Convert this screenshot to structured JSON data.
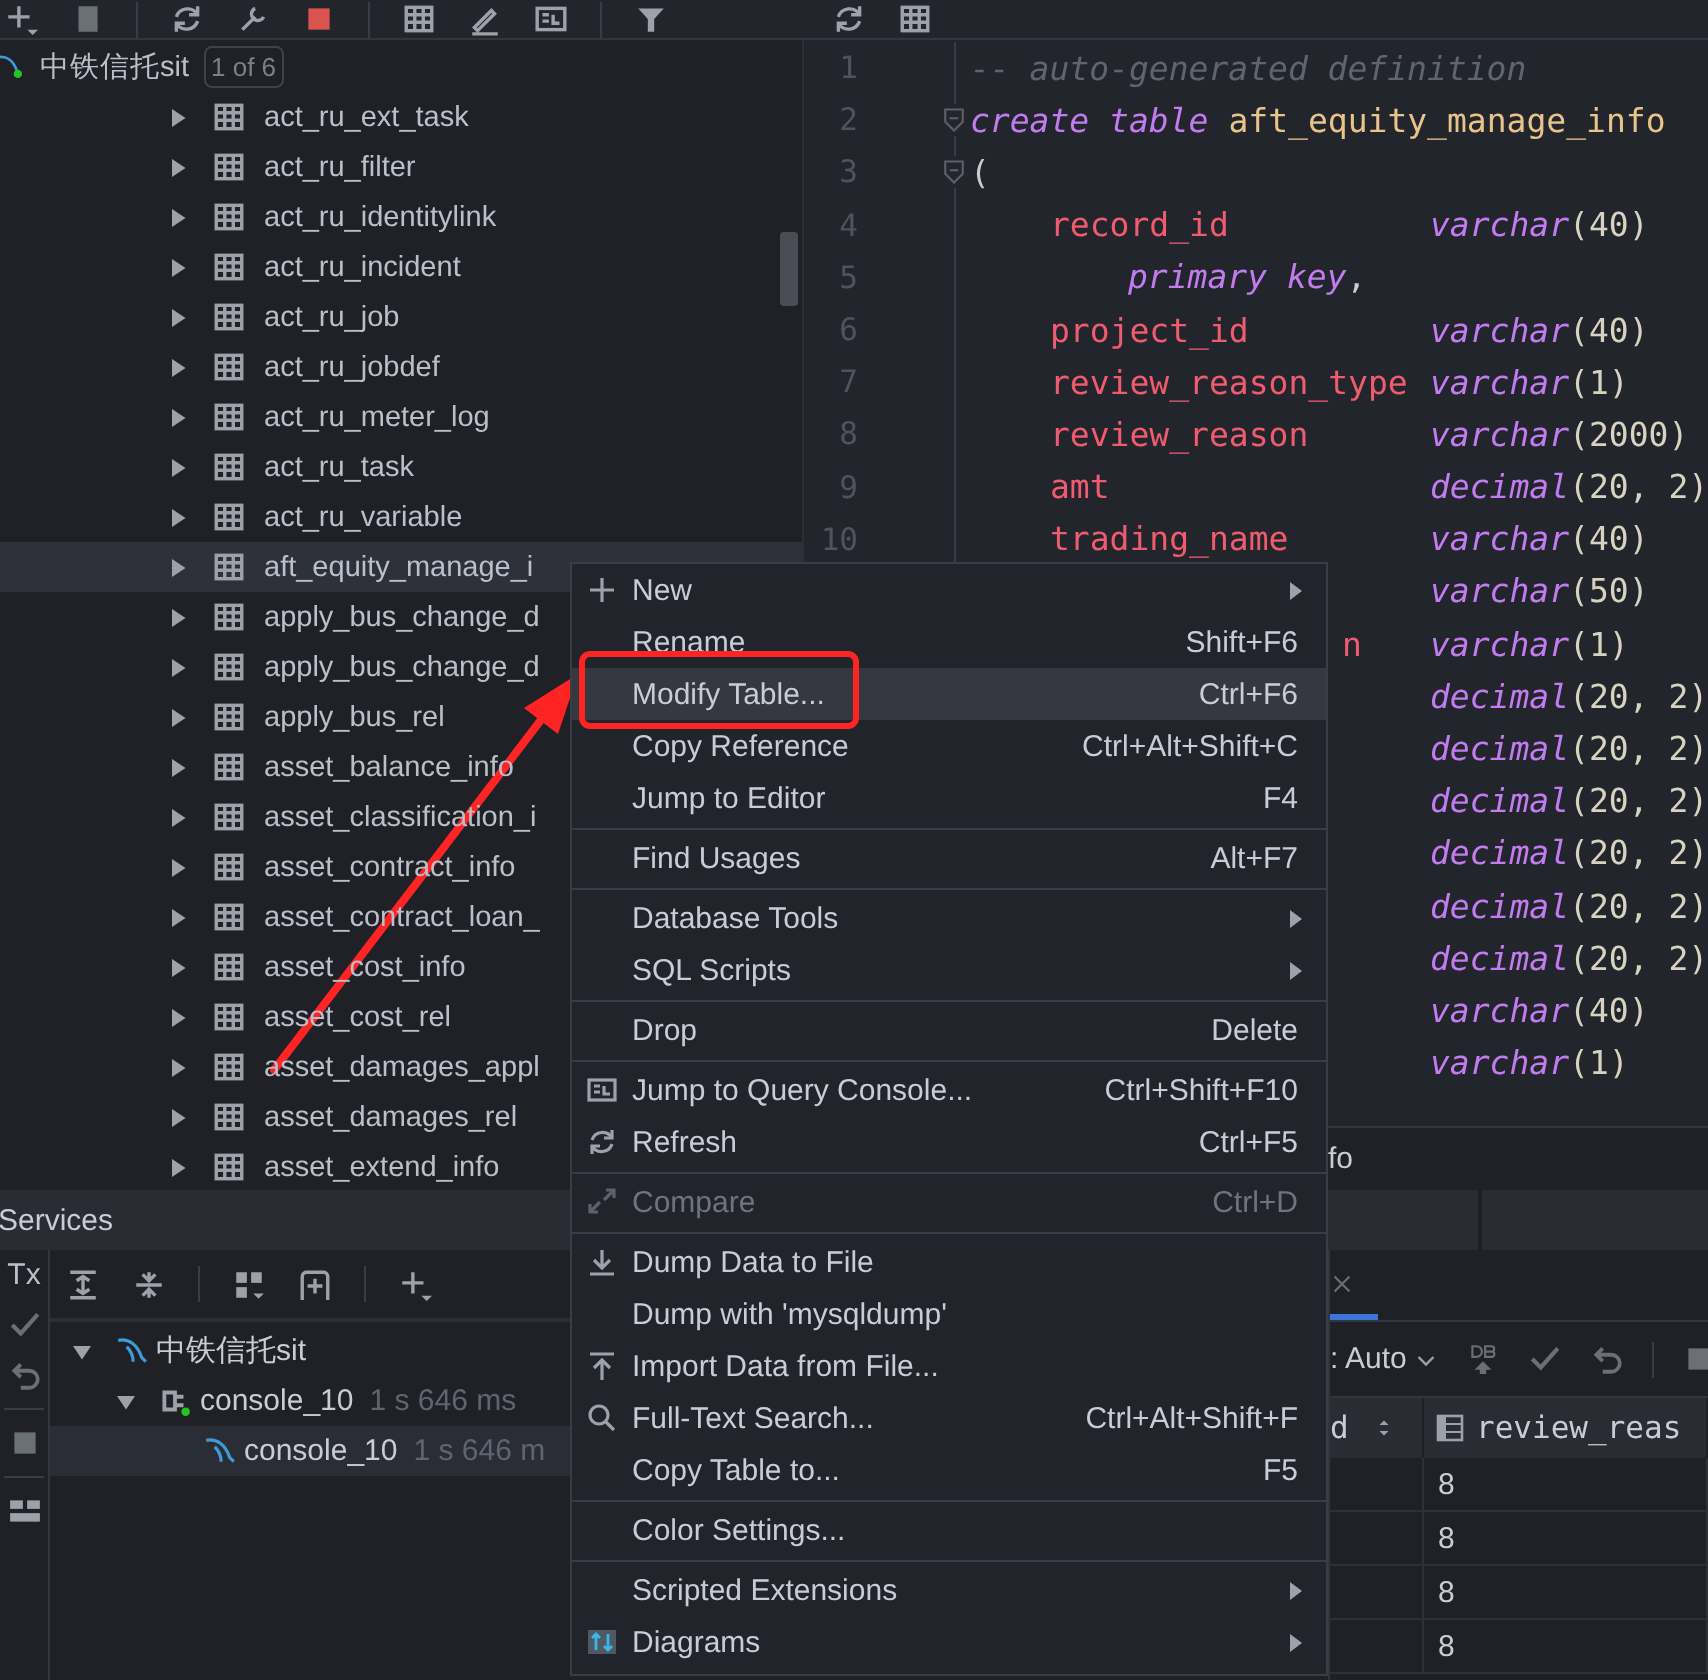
{
  "tree": {
    "source": {
      "name": "中铁信托sit",
      "badge": "1 of 6"
    },
    "items": [
      {
        "label": "act_ru_ext_task",
        "expanded": false,
        "selected": false
      },
      {
        "label": "act_ru_filter",
        "expanded": false,
        "selected": false
      },
      {
        "label": "act_ru_identitylink",
        "expanded": false,
        "selected": false
      },
      {
        "label": "act_ru_incident",
        "expanded": false,
        "selected": false
      },
      {
        "label": "act_ru_job",
        "expanded": false,
        "selected": false
      },
      {
        "label": "act_ru_jobdef",
        "expanded": false,
        "selected": false
      },
      {
        "label": "act_ru_meter_log",
        "expanded": false,
        "selected": false
      },
      {
        "label": "act_ru_task",
        "expanded": false,
        "selected": false
      },
      {
        "label": "act_ru_variable",
        "expanded": false,
        "selected": false
      },
      {
        "label": "aft_equity_manage_i",
        "expanded": false,
        "selected": true
      },
      {
        "label": "apply_bus_change_d",
        "expanded": false,
        "selected": false
      },
      {
        "label": "apply_bus_change_d",
        "expanded": false,
        "selected": false
      },
      {
        "label": "apply_bus_rel",
        "expanded": false,
        "selected": false
      },
      {
        "label": "asset_balance_info",
        "expanded": false,
        "selected": false
      },
      {
        "label": "asset_classification_i",
        "expanded": false,
        "selected": false
      },
      {
        "label": "asset_contract_info",
        "expanded": false,
        "selected": false
      },
      {
        "label": "asset_contract_loan_",
        "expanded": false,
        "selected": false
      },
      {
        "label": "asset_cost_info",
        "expanded": false,
        "selected": false
      },
      {
        "label": "asset_cost_rel",
        "expanded": false,
        "selected": false
      },
      {
        "label": "asset_damages_appl",
        "expanded": false,
        "selected": false
      },
      {
        "label": "asset_damages_rel",
        "expanded": false,
        "selected": false
      },
      {
        "label": "asset_extend_info",
        "expanded": false,
        "selected": false
      }
    ]
  },
  "editor": {
    "lines": [
      {
        "number": "1",
        "kind": "comment",
        "text": "-- auto-generated definition",
        "fold": false
      },
      {
        "number": "2",
        "kind": "create",
        "keyword": "create table",
        "table": "aft_equity_manage_info",
        "fold": true
      },
      {
        "number": "3",
        "kind": "paren",
        "text": "(",
        "fold": true
      },
      {
        "number": "4",
        "kind": "column",
        "name": "record_id",
        "type": "varchar",
        "args": "(40)",
        "fold": false
      },
      {
        "number": "5",
        "kind": "constraint",
        "text": "primary key",
        "punct": ",",
        "fold": false
      },
      {
        "number": "6",
        "kind": "column",
        "name": "project_id",
        "type": "varchar",
        "args": "(40)",
        "fold": false
      },
      {
        "number": "7",
        "kind": "column",
        "name": "review_reason_type",
        "type": "varchar",
        "args": "(1)",
        "fold": false
      },
      {
        "number": "8",
        "kind": "column",
        "name": "review_reason",
        "type": "varchar",
        "args": "(2000)",
        "fold": false
      },
      {
        "number": "9",
        "kind": "column",
        "name": "amt",
        "type": "decimal",
        "args": "(20, 2)",
        "fold": false
      },
      {
        "number": "10",
        "kind": "column",
        "name": "trading_name",
        "type": "varchar",
        "args": "(40)",
        "fold": false
      },
      {
        "kind": "column",
        "type": "varchar",
        "args": "(50)"
      },
      {
        "kind": "column",
        "name": "n",
        "type": "varchar",
        "args": "(1)"
      },
      {
        "kind": "column",
        "type": "decimal",
        "args": "(20, 2)"
      },
      {
        "kind": "column",
        "type": "decimal",
        "args": "(20, 2)"
      },
      {
        "kind": "column",
        "type": "decimal",
        "args": "(20, 2)"
      },
      {
        "kind": "column",
        "type": "decimal",
        "args": "(20, 2)"
      },
      {
        "kind": "column",
        "type": "decimal",
        "args": "(20, 2)"
      },
      {
        "kind": "column",
        "type": "decimal",
        "args": "(20, 2)"
      },
      {
        "kind": "column",
        "type": "varchar",
        "args": "(40)"
      },
      {
        "kind": "column",
        "type": "varchar",
        "args": "(1)"
      }
    ],
    "tab_fragment": "fo"
  },
  "services": {
    "title": "Services",
    "tx_label": "Tx",
    "tree": [
      {
        "label": "中铁信托sit",
        "kind": "datasource",
        "expanded": true,
        "selected": false,
        "children": [
          {
            "label": "console_10",
            "time": "1 s 646 ms",
            "kind": "session",
            "expanded": true,
            "selected": false,
            "children": [
              {
                "label": "console_10",
                "time": "1 s 646 m",
                "kind": "console",
                "selected": true
              }
            ]
          }
        ]
      }
    ]
  },
  "results": {
    "mode": ": Auto",
    "columns": [
      {
        "label": "d",
        "kind": "sortable"
      },
      {
        "label": "review_reas",
        "kind": "field"
      }
    ],
    "rows": [
      {
        "column_2": "8"
      },
      {
        "column_2": "8"
      },
      {
        "column_2": "8"
      },
      {
        "column_2": "8"
      }
    ]
  },
  "context_menu": {
    "entries": [
      {
        "kind": "item",
        "label": "New",
        "submenu": true,
        "disabled": false,
        "selected": false
      },
      {
        "kind": "item",
        "label": "Rename",
        "shortcut": "Shift+F6",
        "submenu": false,
        "disabled": false,
        "selected": false
      },
      {
        "kind": "item",
        "label": "Modify Table...",
        "shortcut": "Ctrl+F6",
        "submenu": false,
        "disabled": false,
        "selected": true
      },
      {
        "kind": "item",
        "label": "Copy Reference",
        "shortcut": "Ctrl+Alt+Shift+C",
        "submenu": false,
        "disabled": false,
        "selected": false
      },
      {
        "kind": "item",
        "label": "Jump to Editor",
        "shortcut": "F4",
        "submenu": false,
        "disabled": false,
        "selected": false
      },
      {
        "kind": "separator"
      },
      {
        "kind": "item",
        "label": "Find Usages",
        "shortcut": "Alt+F7",
        "submenu": false,
        "disabled": false,
        "selected": false
      },
      {
        "kind": "separator"
      },
      {
        "kind": "item",
        "label": "Database Tools",
        "submenu": true,
        "disabled": false,
        "selected": false
      },
      {
        "kind": "item",
        "label": "SQL Scripts",
        "submenu": true,
        "disabled": false,
        "selected": false
      },
      {
        "kind": "separator"
      },
      {
        "kind": "item",
        "label": "Drop",
        "shortcut": "Delete",
        "submenu": false,
        "disabled": false,
        "selected": false
      },
      {
        "kind": "separator"
      },
      {
        "kind": "item",
        "label": "Jump to Query Console...",
        "shortcut": "Ctrl+Shift+F10",
        "submenu": false,
        "disabled": false,
        "selected": false
      },
      {
        "kind": "item",
        "label": "Refresh",
        "shortcut": "Ctrl+F5",
        "submenu": false,
        "disabled": false,
        "selected": false
      },
      {
        "kind": "separator"
      },
      {
        "kind": "item",
        "label": "Compare",
        "shortcut": "Ctrl+D",
        "submenu": false,
        "disabled": true,
        "selected": false
      },
      {
        "kind": "separator"
      },
      {
        "kind": "item",
        "label": "Dump Data to File",
        "submenu": false,
        "disabled": false,
        "selected": false
      },
      {
        "kind": "item",
        "label": "Dump with 'mysqldump'",
        "submenu": false,
        "disabled": false,
        "selected": false
      },
      {
        "kind": "item",
        "label": "Import Data from File...",
        "submenu": false,
        "disabled": false,
        "selected": false
      },
      {
        "kind": "item",
        "label": "Full-Text Search...",
        "shortcut": "Ctrl+Alt+Shift+F",
        "submenu": false,
        "disabled": false,
        "selected": false
      },
      {
        "kind": "item",
        "label": "Copy Table to...",
        "shortcut": "F5",
        "submenu": false,
        "disabled": false,
        "selected": false
      },
      {
        "kind": "separator"
      },
      {
        "kind": "item",
        "label": "Color Settings...",
        "submenu": false,
        "disabled": false,
        "selected": false
      },
      {
        "kind": "separator"
      },
      {
        "kind": "item",
        "label": "Scripted Extensions",
        "submenu": true,
        "disabled": false,
        "selected": false
      },
      {
        "kind": "item",
        "label": "Diagrams",
        "submenu": true,
        "disabled": false,
        "selected": false
      }
    ]
  }
}
